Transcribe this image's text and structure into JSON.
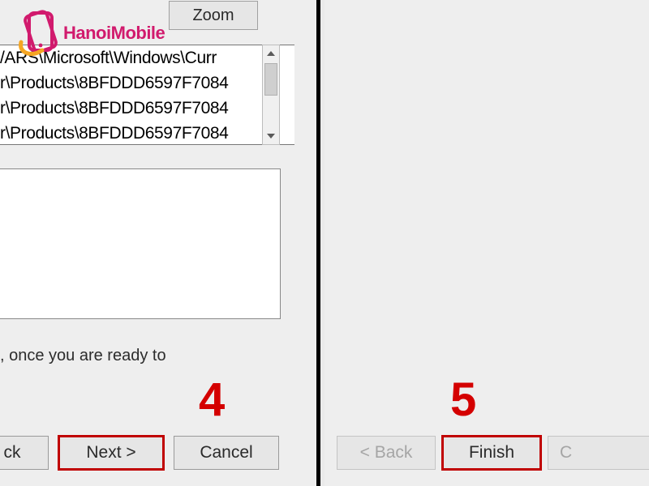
{
  "logo": {
    "text": "HanoiMobile"
  },
  "left": {
    "zoom_label": "Zoom",
    "registry_lines": [
      "/ARS\\Microsoft\\Windows\\Curr",
      "r\\Products\\8BFDDD6597F7084",
      "r\\Products\\8BFDDD6597F7084",
      "r\\Products\\8BFDDD6597F7084"
    ],
    "hint": ", once you are ready to",
    "step_number": "4",
    "buttons": {
      "back": "ck",
      "next": "Next >",
      "cancel": "Cancel"
    }
  },
  "right": {
    "step_number": "5",
    "buttons": {
      "back": "< Back",
      "finish": "Finish",
      "cancel_partial": "C"
    }
  }
}
